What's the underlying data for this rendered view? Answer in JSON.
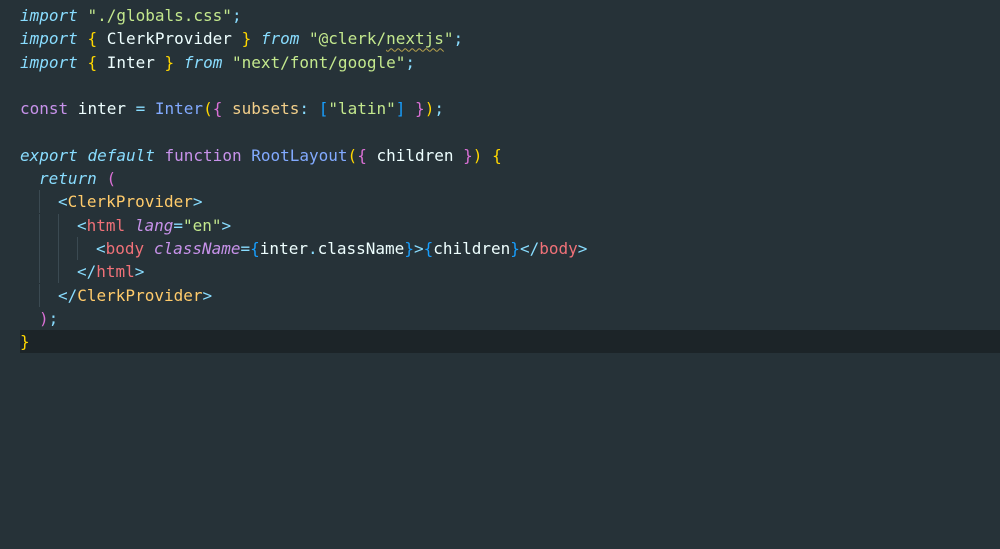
{
  "colors": {
    "background": "#263238",
    "current_line": "#1c2428",
    "keyword": "#c792ea",
    "string": "#c3e88d",
    "function": "#82aaff",
    "tag": "#f07178",
    "component": "#ffcb6b",
    "attribute": "#c792ea",
    "operator": "#89ddff",
    "brace_yellow": "#ffd700",
    "brace_pink": "#da70d6",
    "brace_blue": "#179fff",
    "plain": "#eeffff",
    "warning_squiggle": "#b8a34c"
  },
  "editor": {
    "current_line_number": 15,
    "lines": [
      {
        "indent": 0,
        "tokens": [
          {
            "t": "import",
            "c": "#89ddff",
            "i": true
          },
          {
            "t": " ",
            "c": "#eeffff"
          },
          {
            "t": "\"./globals.css\"",
            "c": "#c3e88d"
          },
          {
            "t": ";",
            "c": "#89ddff"
          }
        ]
      },
      {
        "indent": 0,
        "tokens": [
          {
            "t": "import",
            "c": "#89ddff",
            "i": true
          },
          {
            "t": " ",
            "c": "#eeffff"
          },
          {
            "t": "{",
            "c": "#ffd700"
          },
          {
            "t": " ClerkProvider ",
            "c": "#eeffff"
          },
          {
            "t": "}",
            "c": "#ffd700"
          },
          {
            "t": " ",
            "c": "#eeffff"
          },
          {
            "t": "from",
            "c": "#89ddff",
            "i": true
          },
          {
            "t": " ",
            "c": "#eeffff"
          },
          {
            "t": "\"@clerk/",
            "c": "#c3e88d"
          },
          {
            "t": "nextjs",
            "c": "#c3e88d",
            "w": true
          },
          {
            "t": "\"",
            "c": "#c3e88d"
          },
          {
            "t": ";",
            "c": "#89ddff"
          }
        ]
      },
      {
        "indent": 0,
        "tokens": [
          {
            "t": "import",
            "c": "#89ddff",
            "i": true
          },
          {
            "t": " ",
            "c": "#eeffff"
          },
          {
            "t": "{",
            "c": "#ffd700"
          },
          {
            "t": " Inter ",
            "c": "#eeffff"
          },
          {
            "t": "}",
            "c": "#ffd700"
          },
          {
            "t": " ",
            "c": "#eeffff"
          },
          {
            "t": "from",
            "c": "#89ddff",
            "i": true
          },
          {
            "t": " ",
            "c": "#eeffff"
          },
          {
            "t": "\"next/font/google\"",
            "c": "#c3e88d"
          },
          {
            "t": ";",
            "c": "#89ddff"
          }
        ]
      },
      {
        "indent": 0,
        "tokens": []
      },
      {
        "indent": 0,
        "tokens": [
          {
            "t": "const",
            "c": "#c792ea"
          },
          {
            "t": " inter ",
            "c": "#eeffff"
          },
          {
            "t": "=",
            "c": "#89ddff"
          },
          {
            "t": " ",
            "c": "#eeffff"
          },
          {
            "t": "Inter",
            "c": "#82aaff"
          },
          {
            "t": "(",
            "c": "#ffd700"
          },
          {
            "t": "{",
            "c": "#da70d6"
          },
          {
            "t": " subsets",
            "c": "#f2cf8a"
          },
          {
            "t": ":",
            "c": "#89ddff"
          },
          {
            "t": " ",
            "c": "#eeffff"
          },
          {
            "t": "[",
            "c": "#179fff"
          },
          {
            "t": "\"latin\"",
            "c": "#c3e88d"
          },
          {
            "t": "]",
            "c": "#179fff"
          },
          {
            "t": " ",
            "c": "#eeffff"
          },
          {
            "t": "}",
            "c": "#da70d6"
          },
          {
            "t": ")",
            "c": "#ffd700"
          },
          {
            "t": ";",
            "c": "#89ddff"
          }
        ]
      },
      {
        "indent": 0,
        "tokens": []
      },
      {
        "indent": 0,
        "tokens": [
          {
            "t": "export",
            "c": "#89ddff",
            "i": true
          },
          {
            "t": " ",
            "c": "#eeffff"
          },
          {
            "t": "default",
            "c": "#89ddff",
            "i": true
          },
          {
            "t": " ",
            "c": "#eeffff"
          },
          {
            "t": "function",
            "c": "#c792ea"
          },
          {
            "t": " ",
            "c": "#eeffff"
          },
          {
            "t": "RootLayout",
            "c": "#82aaff"
          },
          {
            "t": "(",
            "c": "#ffd700"
          },
          {
            "t": "{",
            "c": "#da70d6"
          },
          {
            "t": " children ",
            "c": "#eeffff"
          },
          {
            "t": "}",
            "c": "#da70d6"
          },
          {
            "t": ")",
            "c": "#ffd700"
          },
          {
            "t": " ",
            "c": "#eeffff"
          },
          {
            "t": "{",
            "c": "#ffd700"
          }
        ]
      },
      {
        "indent": 1,
        "tokens": [
          {
            "t": "return",
            "c": "#89ddff",
            "i": true
          },
          {
            "t": " ",
            "c": "#eeffff"
          },
          {
            "t": "(",
            "c": "#da70d6"
          }
        ]
      },
      {
        "indent": 2,
        "tokens": [
          {
            "t": "<",
            "c": "#89ddff"
          },
          {
            "t": "ClerkProvider",
            "c": "#ffcb6b"
          },
          {
            "t": ">",
            "c": "#89ddff"
          }
        ]
      },
      {
        "indent": 3,
        "tokens": [
          {
            "t": "<",
            "c": "#89ddff"
          },
          {
            "t": "html",
            "c": "#f07178"
          },
          {
            "t": " ",
            "c": "#eeffff"
          },
          {
            "t": "lang",
            "c": "#c792ea",
            "i": true
          },
          {
            "t": "=",
            "c": "#89ddff"
          },
          {
            "t": "\"en\"",
            "c": "#c3e88d"
          },
          {
            "t": ">",
            "c": "#89ddff"
          }
        ]
      },
      {
        "indent": 4,
        "tokens": [
          {
            "t": "<",
            "c": "#89ddff"
          },
          {
            "t": "body",
            "c": "#f07178"
          },
          {
            "t": " ",
            "c": "#eeffff"
          },
          {
            "t": "className",
            "c": "#c792ea",
            "i": true
          },
          {
            "t": "=",
            "c": "#89ddff"
          },
          {
            "t": "{",
            "c": "#179fff"
          },
          {
            "t": "inter",
            "c": "#eeffff"
          },
          {
            "t": ".",
            "c": "#89ddff"
          },
          {
            "t": "className",
            "c": "#eeffff"
          },
          {
            "t": "}",
            "c": "#179fff"
          },
          {
            "t": ">",
            "c": "#89ddff"
          },
          {
            "t": "{",
            "c": "#179fff"
          },
          {
            "t": "children",
            "c": "#eeffff"
          },
          {
            "t": "}",
            "c": "#179fff"
          },
          {
            "t": "</",
            "c": "#89ddff"
          },
          {
            "t": "body",
            "c": "#f07178"
          },
          {
            "t": ">",
            "c": "#89ddff"
          }
        ]
      },
      {
        "indent": 3,
        "tokens": [
          {
            "t": "</",
            "c": "#89ddff"
          },
          {
            "t": "html",
            "c": "#f07178"
          },
          {
            "t": ">",
            "c": "#89ddff"
          }
        ]
      },
      {
        "indent": 2,
        "tokens": [
          {
            "t": "</",
            "c": "#89ddff"
          },
          {
            "t": "ClerkProvider",
            "c": "#ffcb6b"
          },
          {
            "t": ">",
            "c": "#89ddff"
          }
        ]
      },
      {
        "indent": 1,
        "tokens": [
          {
            "t": ")",
            "c": "#da70d6"
          },
          {
            "t": ";",
            "c": "#89ddff"
          }
        ]
      },
      {
        "indent": 0,
        "tokens": [
          {
            "t": "}",
            "c": "#ffd700"
          }
        ]
      },
      {
        "indent": 0,
        "tokens": []
      }
    ]
  }
}
